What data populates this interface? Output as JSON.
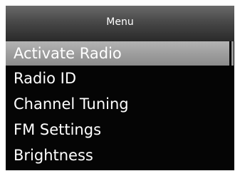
{
  "title_bar": {
    "title": "Menu"
  },
  "menu": {
    "items": [
      {
        "label": "Activate Radio",
        "selected": true
      },
      {
        "label": "Radio ID",
        "selected": false
      },
      {
        "label": "Channel Tuning",
        "selected": false
      },
      {
        "label": "FM Settings",
        "selected": false
      },
      {
        "label": "Brightness",
        "selected": false
      }
    ],
    "selected_index": 0
  },
  "colors": {
    "background": "#050505",
    "highlight": "#9e9e9e",
    "text": "#ffffff",
    "title_bar": "#484848"
  }
}
